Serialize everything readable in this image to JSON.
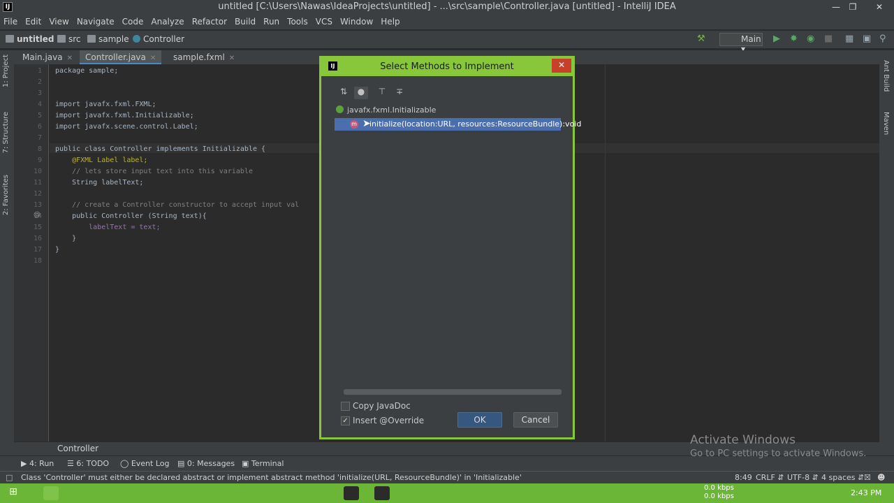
{
  "window": {
    "title": "untitled [C:\\Users\\Nawas\\IdeaProjects\\untitled] - ...\\src\\sample\\Controller.java [untitled] - IntelliJ IDEA"
  },
  "menu": [
    "File",
    "Edit",
    "View",
    "Navigate",
    "Code",
    "Analyze",
    "Refactor",
    "Build",
    "Run",
    "Tools",
    "VCS",
    "Window",
    "Help"
  ],
  "navbar": {
    "crumbs": [
      "untitled",
      "src",
      "sample",
      "Controller"
    ],
    "run_config": "Main"
  },
  "left_tool_tabs": [
    "1: Project",
    "7: Structure",
    "2: Favorites"
  ],
  "right_tool_tabs": [
    "Ant Build",
    "Maven"
  ],
  "editor_tabs": [
    {
      "label": "Main.java",
      "active": false
    },
    {
      "label": "Controller.java",
      "active": true
    },
    {
      "label": "sample.fxml",
      "active": false
    }
  ],
  "editor": {
    "line_numbers": [
      "1",
      "2",
      "3",
      "4",
      "5",
      "6",
      "7",
      "8",
      "9",
      "10",
      "11",
      "12",
      "13",
      "14",
      "15",
      "16",
      "17",
      "18"
    ],
    "lines": [
      "package sample;",
      "",
      "",
      "import javafx.fxml.FXML;",
      "import javafx.fxml.Initializable;",
      "import javafx.scene.control.Label;",
      "",
      "public class Controller implements Initializable {",
      "    @FXML Label label;",
      "    // lets store input text into this variable",
      "    String labelText;",
      "",
      "    // create a Controller constructor to accept input val",
      "    public Controller (String text){",
      "        labelText = text;",
      "    }",
      "}",
      ""
    ]
  },
  "breadcrumb_bottom": "Controller",
  "tool_windows": [
    "4: Run",
    "6: TODO",
    "Event Log",
    "0: Messages",
    "Terminal"
  ],
  "status": {
    "message": "Class 'Controller' must either be declared abstract or implement abstract method 'initialize(URL, ResourceBundle)' in 'Initializable'",
    "position": "8:49",
    "line_sep": "CRLF",
    "encoding": "UTF-8",
    "indent": "4 spaces"
  },
  "dialog": {
    "title": "Select Methods to Implement",
    "tree_parent": "javafx.fxml.Initializable",
    "tree_item": "initialize(location:URL, resources:ResourceBundle):void",
    "copy_javadoc_label": "Copy JavaDoc",
    "copy_javadoc_checked": false,
    "insert_override_label": "Insert @Override",
    "insert_override_checked": true,
    "ok_label": "OK",
    "cancel_label": "Cancel"
  },
  "watermark": {
    "line1": "Activate Windows",
    "line2": "Go to PC settings to activate Windows."
  },
  "taskbar": {
    "net_up": "0.0 kbps",
    "net_down": "0.0 kbps",
    "time": "2:43 PM"
  },
  "colors": {
    "dialog_border": "#88c73a",
    "selection": "#4b6eaf",
    "taskbar": "#6bb537"
  }
}
